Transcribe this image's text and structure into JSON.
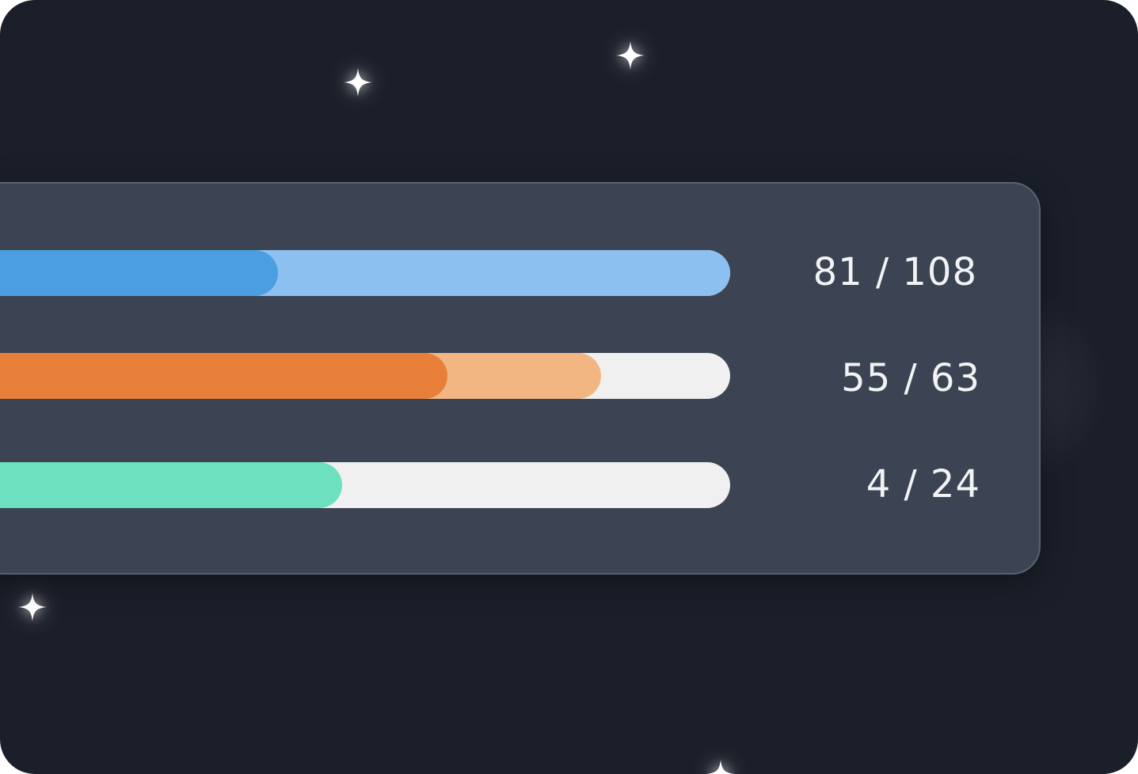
{
  "colors": {
    "background": "#1b1f2a",
    "panel": "#3c4453",
    "track": "#eff0ef",
    "sparkle": "#ffffff"
  },
  "progress_rows": [
    {
      "label": "81 / 108",
      "value": 81,
      "total": 108,
      "primary_color": "#4b9fe0",
      "secondary_color": "#8cc0f0",
      "primary_fraction": 0.44,
      "secondary_fraction": 1.0
    },
    {
      "label": "55 / 63",
      "value": 55,
      "total": 63,
      "primary_color": "#e87f38",
      "secondary_color": "#f2b683",
      "primary_fraction": 0.65,
      "secondary_fraction": 0.84
    },
    {
      "label": "4 / 24",
      "value": 4,
      "total": 24,
      "primary_color": "#6de0c0",
      "primary_fraction": 0.52
    }
  ],
  "decorations": {
    "sparkle_icon": "four-point-star"
  }
}
